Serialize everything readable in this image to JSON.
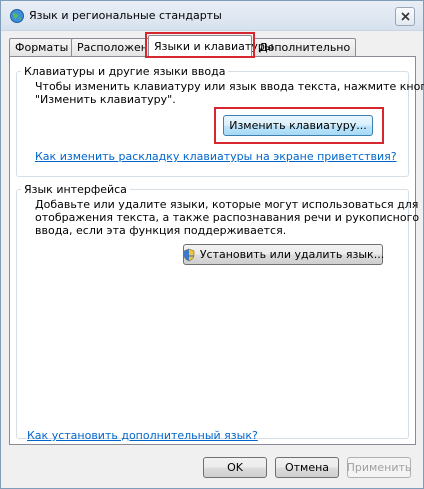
{
  "window": {
    "title": "Язык и региональные стандарты",
    "icon": "globe-icon",
    "close_icon": "close-icon"
  },
  "tabs": [
    {
      "label": "Форматы",
      "active": false
    },
    {
      "label": "Расположение",
      "active": false
    },
    {
      "label": "Языки и клавиатуры",
      "active": true
    },
    {
      "label": "Дополнительно",
      "active": false
    }
  ],
  "keyboards_group": {
    "legend": "Клавиатуры и другие языки ввода",
    "line1": "Чтобы изменить клавиатуру или язык ввода текста, нажмите кнопку",
    "line2": "\"Изменить клавиатуру\".",
    "change_button": "Изменить клавиатуру...",
    "help_link": "Как изменить раскладку клавиатуры на экране приветствия?"
  },
  "ui_language_group": {
    "legend": "Язык интерфейса",
    "line1": "Добавьте или удалите языки, которые могут использоваться для",
    "line2": "отображения текста, а также распознавания речи и рукописного",
    "line3": "ввода, если эта функция поддерживается.",
    "install_button": "Установить или удалить язык...",
    "install_icon": "shield-icon"
  },
  "bottom_link": "Как установить дополнительный язык?",
  "footer": {
    "ok": "OK",
    "cancel": "Отмена",
    "apply": "Применить"
  },
  "colors": {
    "highlight": "#d6272e",
    "link": "#0066cc"
  }
}
